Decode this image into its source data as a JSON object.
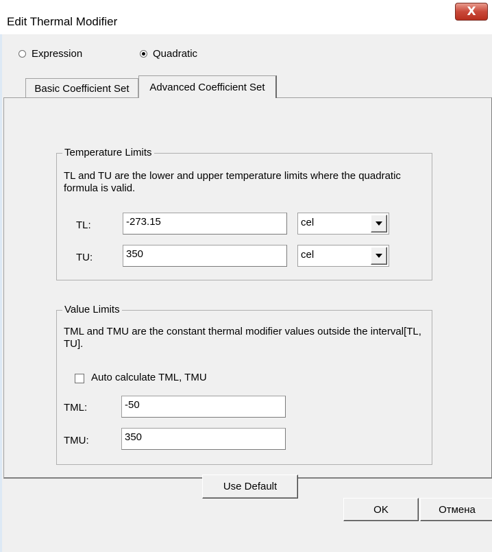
{
  "window": {
    "title": "Edit Thermal Modifier",
    "close_label": "X"
  },
  "mode": {
    "options": [
      {
        "label": "Expression",
        "checked": false
      },
      {
        "label": "Quadratic",
        "checked": true
      }
    ]
  },
  "tabs": [
    {
      "label": "Basic Coefficient Set",
      "active": false
    },
    {
      "label": "Advanced Coefficient Set",
      "active": true
    }
  ],
  "temperature_limits": {
    "legend": "Temperature Limits",
    "description": "TL and TU are the lower and upper temperature limits where the quadratic formula is valid.",
    "tl": {
      "label": "TL:",
      "value": "-273.15",
      "unit": "cel"
    },
    "tu": {
      "label": "TU:",
      "value": "350",
      "unit": "cel"
    }
  },
  "value_limits": {
    "legend": "Value Limits",
    "description": "TML and TMU are the constant thermal modifier values outside the interval[TL, TU].",
    "auto_calc": {
      "label": "Auto calculate TML, TMU",
      "checked": false
    },
    "tml": {
      "label": "TML:",
      "value": "-50"
    },
    "tmu": {
      "label": "TMU:",
      "value": "350"
    }
  },
  "buttons": {
    "use_default": "Use Default",
    "ok": "OK",
    "cancel": "Отмена"
  }
}
